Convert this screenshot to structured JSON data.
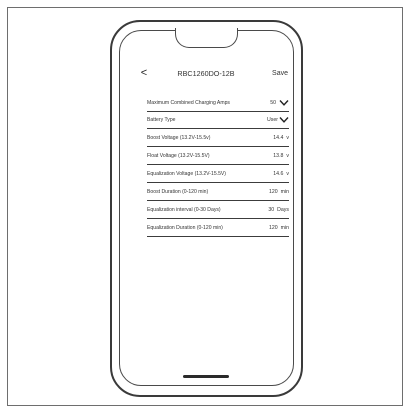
{
  "header": {
    "back_glyph": "<",
    "title": "RBC1260DO-12B",
    "save_label": "Save"
  },
  "settings": [
    {
      "label": "Maximum Combined Charging Amps",
      "value": "50",
      "unit": "",
      "control": "dropdown"
    },
    {
      "label": "Battery Type",
      "value": "User",
      "unit": "",
      "control": "dropdown"
    },
    {
      "label": "Boost Voltage (13.2V-15.5v)",
      "value": "14.4",
      "unit": "v",
      "control": "text"
    },
    {
      "label": "Float Voltage (13.2V-15.5V)",
      "value": "13.8",
      "unit": "v",
      "control": "text"
    },
    {
      "label": "Equalization Voltage (13.2V-15.5V)",
      "value": "14.6",
      "unit": "v",
      "control": "text"
    },
    {
      "label": "Boost Duration (0-120 min)",
      "value": "120",
      "unit": "min",
      "control": "text"
    },
    {
      "label": "Equalization interval (0-30 Days)",
      "value": "30",
      "unit": "Days",
      "control": "text"
    },
    {
      "label": "Equalization Duration (0-120 min)",
      "value": "120",
      "unit": "min",
      "control": "text"
    }
  ],
  "icons": {
    "back": "chevron-left-icon",
    "dropdown": "chevron-down-icon"
  }
}
